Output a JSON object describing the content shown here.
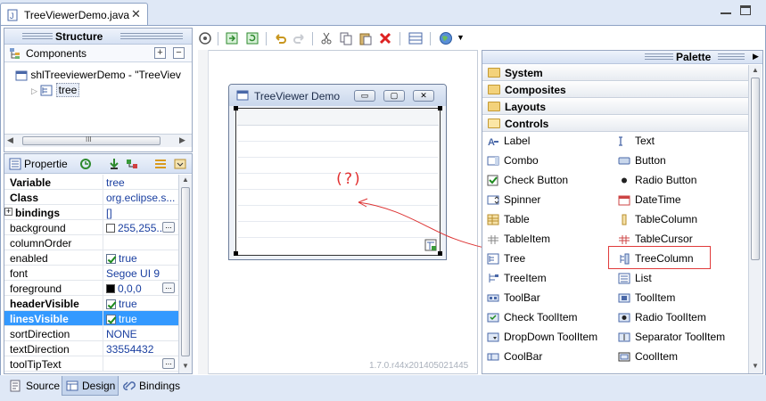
{
  "editor": {
    "tab_title": "TreeViewerDemo.java",
    "close_glyph": "✕"
  },
  "structure": {
    "title": "Structure",
    "components_label": "Components",
    "expand_glyph": "+",
    "collapse_glyph": "−",
    "tree": [
      {
        "label": "shlTreeviewerDemo - \"TreeViev"
      },
      {
        "label": "tree"
      }
    ],
    "scroll_glyph": "III"
  },
  "properties": {
    "title": "Propertie",
    "rows": [
      {
        "name": "Variable",
        "value": "tree"
      },
      {
        "name": "Class",
        "value": "org.eclipse.s..."
      },
      {
        "name": "bindings",
        "value": "[]"
      },
      {
        "name": "background",
        "value": "255,255..."
      },
      {
        "name": "columnOrder",
        "value": ""
      },
      {
        "name": "enabled",
        "value": "true"
      },
      {
        "name": "font",
        "value": "Segoe UI 9"
      },
      {
        "name": "foreground",
        "value": "0,0,0"
      },
      {
        "name": "headerVisible",
        "value": "true"
      },
      {
        "name": "linesVisible",
        "value": "true"
      },
      {
        "name": "sortDirection",
        "value": "NONE"
      },
      {
        "name": "textDirection",
        "value": "33554432"
      },
      {
        "name": "toolTipText",
        "value": ""
      }
    ],
    "dots_glyph": "...",
    "expand_glyph": "+"
  },
  "preview": {
    "window_title": "TreeViewer Demo",
    "question_annotation": "(?)",
    "min_glyph": "▭",
    "max_glyph": "▢",
    "close_glyph": "✕"
  },
  "version_text": "1.7.0.r44x201405021445",
  "palette": {
    "title": "Palette",
    "categories": [
      "System",
      "Composites",
      "Layouts",
      "Controls"
    ],
    "items": [
      {
        "label": "Label",
        "icon": "label-icon"
      },
      {
        "label": "Text",
        "icon": "text-icon"
      },
      {
        "label": "Combo",
        "icon": "combo-icon"
      },
      {
        "label": "Button",
        "icon": "button-icon"
      },
      {
        "label": "Check Button",
        "icon": "check-button-icon"
      },
      {
        "label": "Radio Button",
        "icon": "radio-button-icon"
      },
      {
        "label": "Spinner",
        "icon": "spinner-icon"
      },
      {
        "label": "DateTime",
        "icon": "datetime-icon"
      },
      {
        "label": "Table",
        "icon": "table-icon"
      },
      {
        "label": "TableColumn",
        "icon": "table-column-icon"
      },
      {
        "label": "TableItem",
        "icon": "table-item-icon"
      },
      {
        "label": "TableCursor",
        "icon": "table-cursor-icon"
      },
      {
        "label": "Tree",
        "icon": "tree-icon"
      },
      {
        "label": "TreeColumn",
        "icon": "tree-column-icon"
      },
      {
        "label": "TreeItem",
        "icon": "tree-item-icon"
      },
      {
        "label": "List",
        "icon": "list-icon"
      },
      {
        "label": "ToolBar",
        "icon": "toolbar-icon"
      },
      {
        "label": "ToolItem",
        "icon": "tool-item-icon"
      },
      {
        "label": "Check ToolItem",
        "icon": "check-toolitem-icon"
      },
      {
        "label": "Radio ToolItem",
        "icon": "radio-toolitem-icon"
      },
      {
        "label": "DropDown ToolItem",
        "icon": "dropdown-toolitem-icon"
      },
      {
        "label": "Separator ToolItem",
        "icon": "separator-toolitem-icon"
      },
      {
        "label": "CoolBar",
        "icon": "coolbar-icon"
      },
      {
        "label": "CoolItem",
        "icon": "coolitem-icon"
      }
    ]
  },
  "bottom_tabs": [
    {
      "label": "Source"
    },
    {
      "label": "Design"
    },
    {
      "label": "Bindings"
    }
  ],
  "colors": {
    "accent": "#3399ff",
    "annotation": "#e23030",
    "panel_border": "#99a8c2"
  }
}
